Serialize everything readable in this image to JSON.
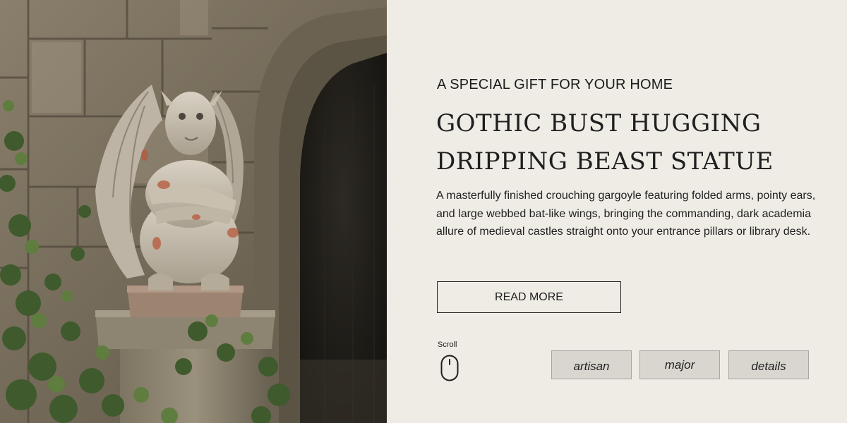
{
  "banner": {
    "eyebrow": "A SPECIAL GIFT FOR YOUR HOME",
    "title_line1": "GOTHIC BUST HUGGING",
    "title_line2": "DRIPPING BEAST STATUE",
    "description": "A masterfully finished crouching gargoyle featuring folded arms, pointy ears, and large webbed bat-like wings, bringing the commanding, dark academia allure of medieval castles straight onto your entrance pillars or library desk.",
    "cta_label": "READ MORE"
  },
  "scroll": {
    "label": "Scroll",
    "icon": "mouse-icon"
  },
  "tags": [
    {
      "label": "artisan"
    },
    {
      "label": "major"
    },
    {
      "label": "details"
    }
  ],
  "colors": {
    "panel_background": "#efece6",
    "text": "#1f1f1f",
    "tag_background": "#d9d6d0",
    "tag_border": "#a9a6a1"
  },
  "image": {
    "subject": "stone gargoyle statue crouching on an ivy-covered pillar beside a gothic stone archway"
  }
}
